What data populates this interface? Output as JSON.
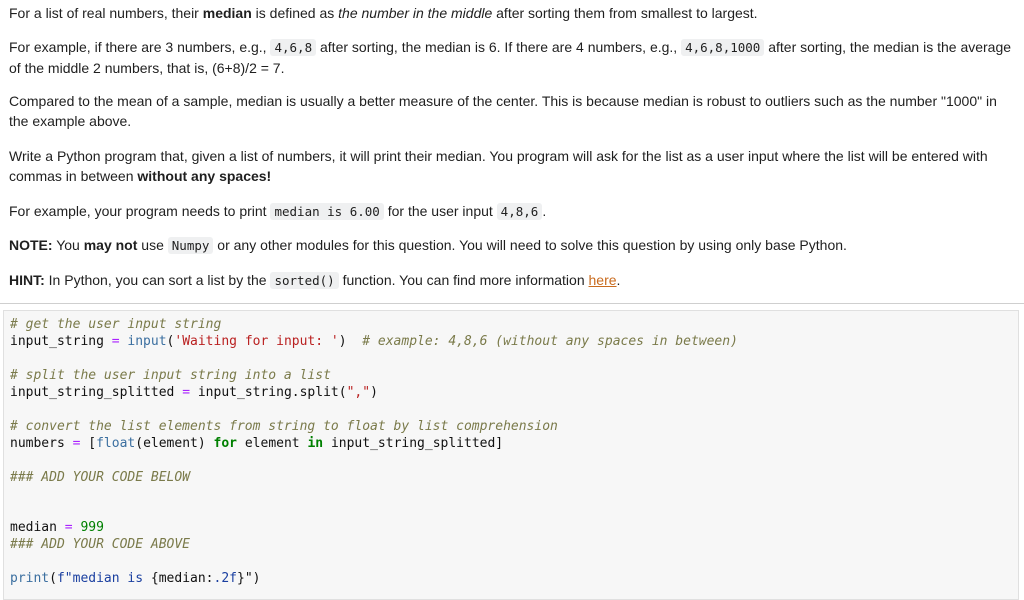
{
  "markdown": {
    "p1": {
      "a": "For a list of real numbers, their ",
      "b": "median",
      "c": " is defined as ",
      "d": "the number in the middle",
      "e": " after sorting them from smallest to largest."
    },
    "p2": {
      "a": "For example, if there are 3 numbers, e.g., ",
      "code1": "4,6,8",
      "b": " after sorting, the median is 6. If there are 4 numbers, e.g., ",
      "code2": "4,6,8,1000",
      "c": " after sorting, the median is the average of the middle 2 numbers, that is, (6+8)/2 = 7."
    },
    "p3": "Compared to the mean of a sample, median is usually a better measure of the center. This is because median is robust to outliers such as the number \"1000\" in the example above.",
    "p4": {
      "a": "Write a Python program that, given a list of numbers, it will print their median. You program will ask for the list as a user input where the list will be entered with commas in between ",
      "b": "without any spaces!"
    },
    "p5": {
      "a": "For example, your program needs to print ",
      "code1": "median is 6.00",
      "b": " for the user input ",
      "code2": "4,8,6",
      "c": "."
    },
    "p6": {
      "label": "NOTE:",
      "a": " You ",
      "b": "may not",
      "c": " use ",
      "code": "Numpy",
      "d": " or any other modules for this question. You will need to solve this question by using only base Python."
    },
    "p7": {
      "label": "HINT:",
      "a": " In Python, you can sort a list by the ",
      "code": "sorted()",
      "b": " function. You can find more information ",
      "link": "here",
      "c": "."
    }
  },
  "code_cell": {
    "l1": "# get the user input string",
    "l2": {
      "var": "input_string",
      "eq": " = ",
      "fn": "input",
      "open": "(",
      "str": "'Waiting for input: '",
      "close": ")",
      "comment": "# example: 4,8,6 (without any spaces in between)"
    },
    "l3": "# split the user input string into a list",
    "l4": {
      "var": "input_string_splitted",
      "eq": " = ",
      "rest": "input_string.split(",
      "str": "\",\"",
      "close": ")"
    },
    "l5": "# convert the list elements from string to float by list comprehension",
    "l6": {
      "var": "numbers",
      "eq": " = ",
      "open": "[",
      "fn": "float",
      "mid": "(element) ",
      "kw1": "for",
      "mid2": " element ",
      "kw2": "in",
      "rest": " input_string_splitted]"
    },
    "l7": "### ADD YOUR CODE BELOW",
    "l8": {
      "var": "median",
      "eq": " = ",
      "num": "999"
    },
    "l9": "### ADD YOUR CODE ABOVE",
    "l10": {
      "fn": "print",
      "open": "(",
      "fpre": "f\"median is ",
      "fexpr": "{median:",
      "fspec": ".2f",
      "fend": "}\"",
      "close": ")"
    }
  }
}
